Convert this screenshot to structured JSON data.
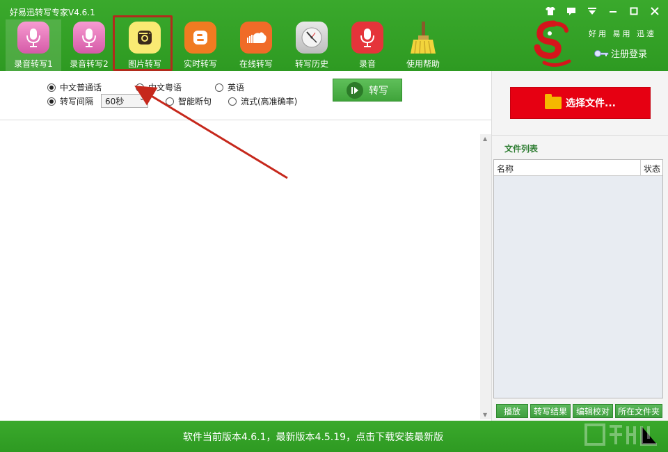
{
  "app": {
    "title": "好易迅转写专家V4.6.1"
  },
  "window_controls": [
    {
      "name": "skin-icon",
      "glyph": "👕"
    },
    {
      "name": "message-icon",
      "glyph": "▣"
    },
    {
      "name": "menu-icon",
      "glyph": "▼"
    },
    {
      "name": "minimize-icon",
      "glyph": "—"
    },
    {
      "name": "maximize-icon",
      "glyph": "□"
    },
    {
      "name": "close-icon",
      "glyph": "✕"
    }
  ],
  "toolbar": {
    "items": [
      {
        "label": "录音转写1",
        "icon": "microphone-pink-icon",
        "active": true
      },
      {
        "label": "录音转写2",
        "icon": "microphone-pink-icon"
      },
      {
        "label": "图片转写",
        "icon": "instagram-camera-icon",
        "highlighted": true
      },
      {
        "label": "实时转写",
        "icon": "blogger-icon"
      },
      {
        "label": "在线转写",
        "icon": "soundcloud-icon"
      },
      {
        "label": "转写历史",
        "icon": "clock-icon"
      },
      {
        "label": "录音",
        "icon": "microphone-red-icon"
      },
      {
        "label": "使用帮助",
        "icon": "broom-icon"
      }
    ]
  },
  "brand": {
    "slogan": "好用 易用 迅速",
    "login_label": "注册登录"
  },
  "options": {
    "language": [
      {
        "label": "中文普通话",
        "checked": true
      },
      {
        "label": "中文粤语",
        "checked": false
      },
      {
        "label": "英语",
        "checked": false
      }
    ],
    "mode": [
      {
        "label": "转写间隔",
        "checked": true
      },
      {
        "label": "智能断句",
        "checked": false
      },
      {
        "label": "流式(高准确率)",
        "checked": false
      }
    ],
    "interval_value": "60秒",
    "convert_label": "转写"
  },
  "right_panel": {
    "select_file_label": "选择文件...",
    "file_list_title": "文件列表",
    "columns": [
      "名称",
      "状态"
    ],
    "buttons": [
      "播放",
      "转写结果",
      "编辑校对",
      "所在文件夹"
    ]
  },
  "statusbar": {
    "text": "软件当前版本4.6.1，最新版本4.5.19，点击下载安装最新版"
  },
  "colors": {
    "header_green": "#3aa92c",
    "select_red": "#e60012",
    "annotation_red": "#b22b1c"
  }
}
